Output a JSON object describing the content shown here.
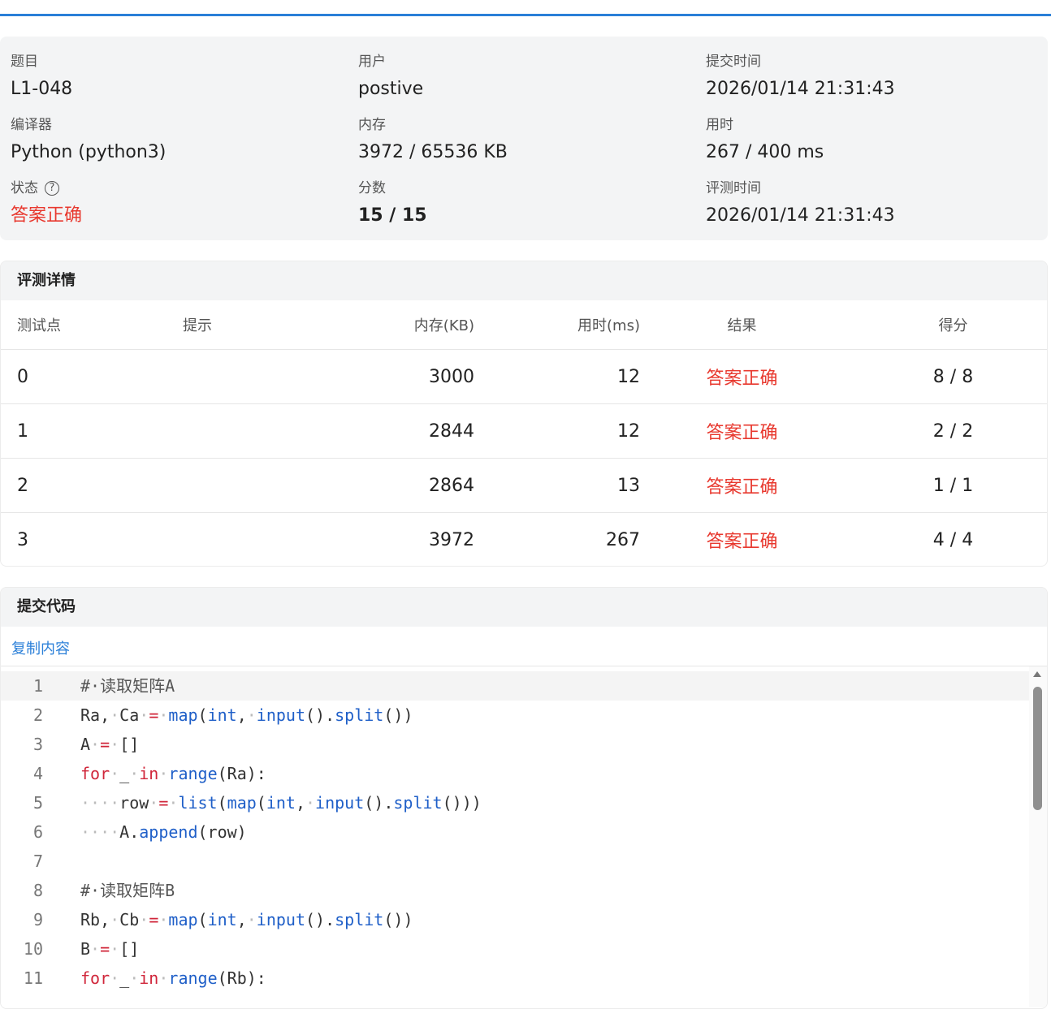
{
  "info": {
    "problem_label": "题目",
    "problem_value": "L1-048",
    "user_label": "用户",
    "user_value": "postive",
    "submit_time_label": "提交时间",
    "submit_time_value": "2026/01/14 21:31:43",
    "compiler_label": "编译器",
    "compiler_value": "Python (python3)",
    "memory_label": "内存",
    "memory_value": "3972 / 65536 KB",
    "time_label": "用时",
    "time_value": "267 / 400 ms",
    "status_label": "状态",
    "status_help_icon": "?",
    "status_value": "答案正确",
    "score_label": "分数",
    "score_value": "15 / 15",
    "judge_time_label": "评测时间",
    "judge_time_value": "2026/01/14 21:31:43"
  },
  "judge": {
    "title": "评测详情",
    "headers": {
      "test": "测试点",
      "hint": "提示",
      "mem": "内存(KB)",
      "time": "用时(ms)",
      "result": "结果",
      "score": "得分"
    },
    "rows": [
      {
        "test": "0",
        "hint": "",
        "mem": "3000",
        "time": "12",
        "result": "答案正确",
        "score": "8 / 8"
      },
      {
        "test": "1",
        "hint": "",
        "mem": "2844",
        "time": "12",
        "result": "答案正确",
        "score": "2 / 2"
      },
      {
        "test": "2",
        "hint": "",
        "mem": "2864",
        "time": "13",
        "result": "答案正确",
        "score": "1 / 1"
      },
      {
        "test": "3",
        "hint": "",
        "mem": "3972",
        "time": "267",
        "result": "答案正确",
        "score": "4 / 4"
      }
    ]
  },
  "code": {
    "title": "提交代码",
    "copy_label": "复制内容",
    "current_line": 1,
    "lines": [
      {
        "n": "1",
        "tokens": [
          [
            "comment",
            "#·读取矩阵A"
          ]
        ]
      },
      {
        "n": "2",
        "tokens": [
          [
            "plain",
            "Ra,"
          ],
          [
            "dot",
            "·"
          ],
          [
            "plain",
            "Ca"
          ],
          [
            "dot",
            "·"
          ],
          [
            "op",
            "="
          ],
          [
            "dot",
            "·"
          ],
          [
            "fn",
            "map"
          ],
          [
            "plain",
            "("
          ],
          [
            "fn",
            "int"
          ],
          [
            "plain",
            ","
          ],
          [
            "dot",
            "·"
          ],
          [
            "fn",
            "input"
          ],
          [
            "plain",
            "()."
          ],
          [
            "fn",
            "split"
          ],
          [
            "plain",
            "())"
          ]
        ]
      },
      {
        "n": "3",
        "tokens": [
          [
            "plain",
            "A"
          ],
          [
            "dot",
            "·"
          ],
          [
            "op",
            "="
          ],
          [
            "dot",
            "·"
          ],
          [
            "plain",
            "[]"
          ]
        ]
      },
      {
        "n": "4",
        "tokens": [
          [
            "kw",
            "for"
          ],
          [
            "dot",
            "·"
          ],
          [
            "plain",
            "_"
          ],
          [
            "dot",
            "·"
          ],
          [
            "kw",
            "in"
          ],
          [
            "dot",
            "·"
          ],
          [
            "fn",
            "range"
          ],
          [
            "plain",
            "(Ra):"
          ]
        ]
      },
      {
        "n": "5",
        "tokens": [
          [
            "dot",
            "····"
          ],
          [
            "plain",
            "row"
          ],
          [
            "dot",
            "·"
          ],
          [
            "op",
            "="
          ],
          [
            "dot",
            "·"
          ],
          [
            "fn",
            "list"
          ],
          [
            "plain",
            "("
          ],
          [
            "fn",
            "map"
          ],
          [
            "plain",
            "("
          ],
          [
            "fn",
            "int"
          ],
          [
            "plain",
            ","
          ],
          [
            "dot",
            "·"
          ],
          [
            "fn",
            "input"
          ],
          [
            "plain",
            "()."
          ],
          [
            "fn",
            "split"
          ],
          [
            "plain",
            "()))"
          ]
        ]
      },
      {
        "n": "6",
        "tokens": [
          [
            "dot",
            "····"
          ],
          [
            "plain",
            "A."
          ],
          [
            "fn",
            "append"
          ],
          [
            "plain",
            "(row)"
          ]
        ]
      },
      {
        "n": "7",
        "tokens": []
      },
      {
        "n": "8",
        "tokens": [
          [
            "comment",
            "#·读取矩阵B"
          ]
        ]
      },
      {
        "n": "9",
        "tokens": [
          [
            "plain",
            "Rb,"
          ],
          [
            "dot",
            "·"
          ],
          [
            "plain",
            "Cb"
          ],
          [
            "dot",
            "·"
          ],
          [
            "op",
            "="
          ],
          [
            "dot",
            "·"
          ],
          [
            "fn",
            "map"
          ],
          [
            "plain",
            "("
          ],
          [
            "fn",
            "int"
          ],
          [
            "plain",
            ","
          ],
          [
            "dot",
            "·"
          ],
          [
            "fn",
            "input"
          ],
          [
            "plain",
            "()."
          ],
          [
            "fn",
            "split"
          ],
          [
            "plain",
            "())"
          ]
        ]
      },
      {
        "n": "10",
        "tokens": [
          [
            "plain",
            "B"
          ],
          [
            "dot",
            "·"
          ],
          [
            "op",
            "="
          ],
          [
            "dot",
            "·"
          ],
          [
            "plain",
            "[]"
          ]
        ]
      },
      {
        "n": "11",
        "tokens": [
          [
            "kw",
            "for"
          ],
          [
            "dot",
            "·"
          ],
          [
            "plain",
            "_"
          ],
          [
            "dot",
            "·"
          ],
          [
            "kw",
            "in"
          ],
          [
            "dot",
            "·"
          ],
          [
            "fn",
            "range"
          ],
          [
            "plain",
            "(Rb):"
          ]
        ]
      }
    ]
  },
  "colors": {
    "accent": "#2a7fd8",
    "success": "#e8382e",
    "keyword": "#d0263a",
    "function": "#1f5fc8"
  }
}
